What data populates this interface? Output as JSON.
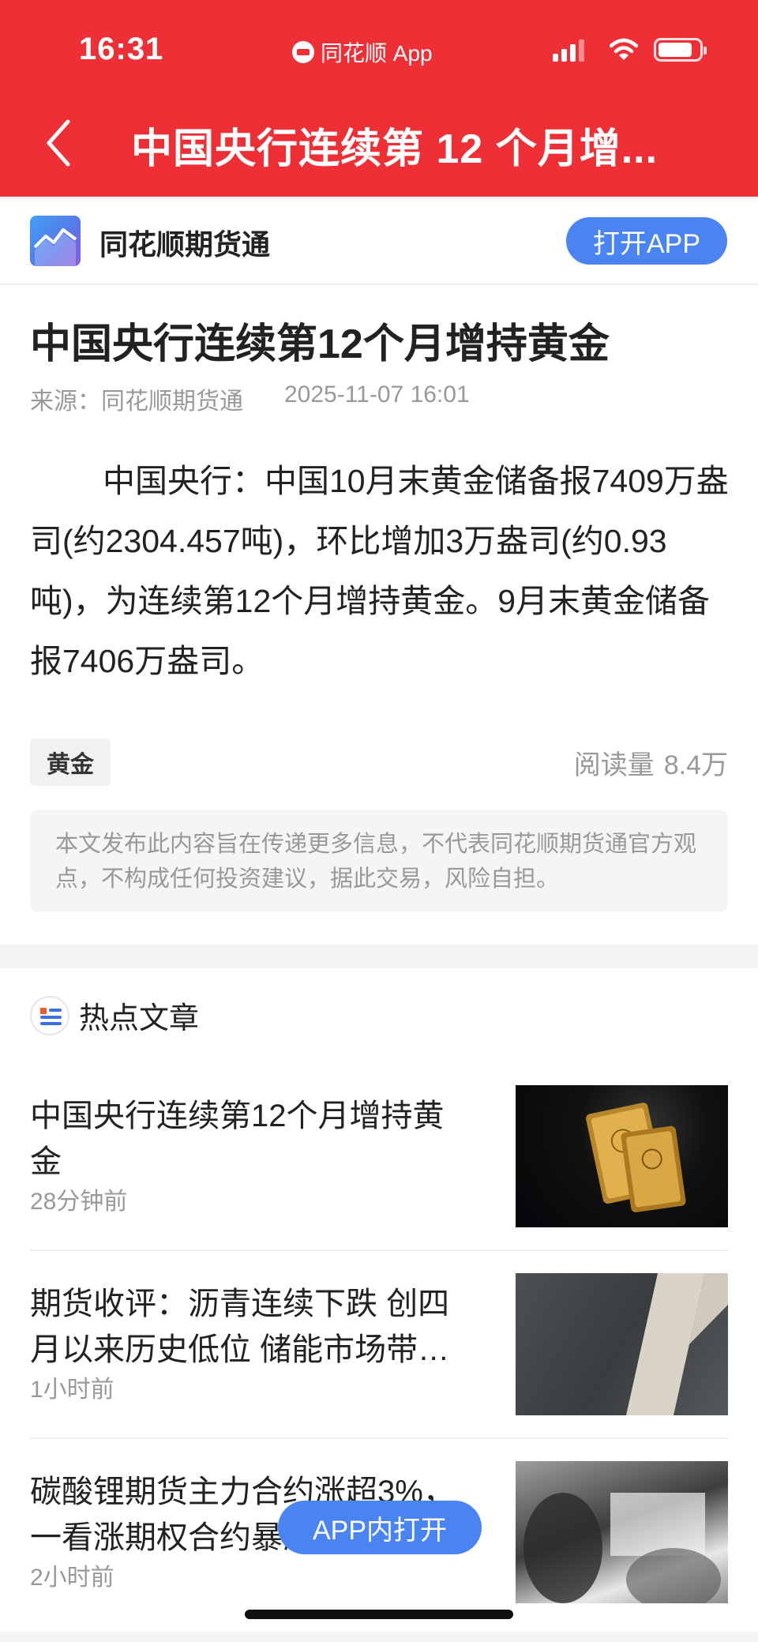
{
  "status": {
    "time": "16:31",
    "carrier": "同花顺 App"
  },
  "nav": {
    "title": "中国央行连续第 12 个月增..."
  },
  "app_banner": {
    "name": "同花顺期货通",
    "open_label": "打开APP"
  },
  "article": {
    "title": "中国央行连续第12个月增持黄金",
    "source": "来源：同花顺期货通",
    "datetime": "2025-11-07 16:01",
    "body": "中国央行：中国10月末黄金储备报7409万盎司(约2304.457吨)，环比增加3万盎司(约0.93吨)，为连续第12个月增持黄金。9月末黄金储备报7406万盎司。",
    "tag": "黄金",
    "reads_label": "阅读量",
    "reads_value": "8.4万",
    "disclaimer": "本文发布此内容旨在传递更多信息，不代表同花顺期货通官方观点，不构成任何投资建议，据此交易，风险自担。"
  },
  "hot": {
    "heading": "热点文章",
    "items": [
      {
        "title": "中国央行连续第12个月增持黄金",
        "time": "28分钟前",
        "thumb": "gold-bars"
      },
      {
        "title": "期货收评：沥青连续下跌 创四月以来历史低位 储能市场带…",
        "time": "1小时前",
        "thumb": "asphalt-road"
      },
      {
        "title": "碳酸锂期货主力合约涨超3%，一看涨期权合约暴涨",
        "time": "2小时前",
        "thumb": "business-meeting"
      }
    ]
  },
  "float_button": {
    "label": "APP内打开"
  },
  "colors": {
    "brand_red": "#ee2f35",
    "accent_blue": "#4a84f3"
  }
}
